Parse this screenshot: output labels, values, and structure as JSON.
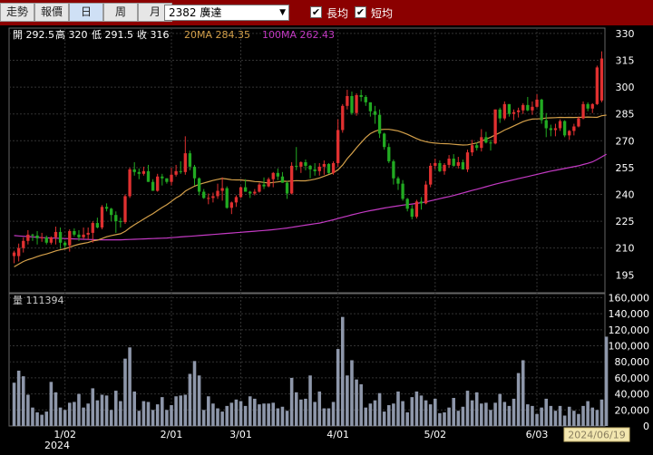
{
  "toolbar": {
    "tabs": [
      "走勢",
      "報價",
      "日",
      "周",
      "月"
    ],
    "active_tab": 2,
    "stock_select": "2382 廣達",
    "checkbox_long": {
      "label": "長均",
      "checked": true
    },
    "checkbox_short": {
      "label": "短均",
      "checked": true
    }
  },
  "info": {
    "open": "開 292.5",
    "high": "高 320",
    "low": "低 291.5",
    "close": "收 316",
    "ma20": "20MA 284.35",
    "ma100": "100MA 262.43",
    "volume": "量 111394"
  },
  "colors": {
    "up": "#e03030",
    "down": "#22aa22",
    "ma20": "#d4a04a",
    "ma100": "#c43ac4",
    "volume": "#8e97aa",
    "grid": "#333333",
    "titlebar": "#8b0000"
  },
  "hover_date": "2024/06/19",
  "chart_data": {
    "type": "candlestick",
    "price_axis_ticks": [
      330,
      315,
      300,
      285,
      270,
      255,
      240,
      225,
      210,
      195
    ],
    "price_range": [
      185,
      333
    ],
    "volume_axis_ticks": [
      "160,000",
      "140,000",
      "120,000",
      "100,000",
      "80,000",
      "60,000",
      "40,000",
      "20,000",
      "0"
    ],
    "volume_range": [
      0,
      165000
    ],
    "x_ticks": [
      {
        "label": "1/02",
        "index": 11
      },
      {
        "label": "2/01",
        "index": 34
      },
      {
        "label": "3/01",
        "index": 49
      },
      {
        "label": "4/01",
        "index": 70
      },
      {
        "label": "5/02",
        "index": 91
      },
      {
        "label": "6/03",
        "index": 113
      }
    ],
    "year_label": "2024",
    "ohlc": [
      [
        205.5,
        208.5,
        201.5,
        207.5
      ],
      [
        205.5,
        212.5,
        202.5,
        210.0
      ],
      [
        210.0,
        216.0,
        207.5,
        214.0
      ],
      [
        214.0,
        220.0,
        212.0,
        217.5
      ],
      [
        217.5,
        218.0,
        214.0,
        217.0
      ],
      [
        217.0,
        219.5,
        212.0,
        215.5
      ],
      [
        215.5,
        218.5,
        213.5,
        216.0
      ],
      [
        216.0,
        217.0,
        212.0,
        213.0
      ],
      [
        213.0,
        216.5,
        212.0,
        216.0
      ],
      [
        216.0,
        222.0,
        212.0,
        219.0
      ],
      [
        219.0,
        221.5,
        209.5,
        213.0
      ],
      [
        213.0,
        214.0,
        210.0,
        211.5
      ],
      [
        211.5,
        220.5,
        208.0,
        219.5
      ],
      [
        219.5,
        221.0,
        216.5,
        217.5
      ],
      [
        217.5,
        220.0,
        214.0,
        216.0
      ],
      [
        216.0,
        221.5,
        215.0,
        217.5
      ],
      [
        217.5,
        221.5,
        214.5,
        218.5
      ],
      [
        218.5,
        225.0,
        213.0,
        224.0
      ],
      [
        224.0,
        227.0,
        221.0,
        221.5
      ],
      [
        221.5,
        234.0,
        220.5,
        233.0
      ],
      [
        233.0,
        235.0,
        230.5,
        232.0
      ],
      [
        232.0,
        232.5,
        225.0,
        228.5
      ],
      [
        228.5,
        230.5,
        218.5,
        225.0
      ],
      [
        225.0,
        227.0,
        221.5,
        224.5
      ],
      [
        224.5,
        240.0,
        223.5,
        239.0
      ],
      [
        239.0,
        255.0,
        238.0,
        254.0
      ],
      [
        254.0,
        258.0,
        250.5,
        252.5
      ],
      [
        252.5,
        254.5,
        248.5,
        251.5
      ],
      [
        251.5,
        255.5,
        250.5,
        253.0
      ],
      [
        253.0,
        256.5,
        247.0,
        247.0
      ],
      [
        247.0,
        248.5,
        242.0,
        242.0
      ],
      [
        242.0,
        251.5,
        241.5,
        250.0
      ],
      [
        250.0,
        251.5,
        245.0,
        249.0
      ],
      [
        249.0,
        249.0,
        246.0,
        247.0
      ],
      [
        247.0,
        255.0,
        245.0,
        251.0
      ],
      [
        251.0,
        256.5,
        250.0,
        253.0
      ],
      [
        253.0,
        258.5,
        251.5,
        252.5
      ],
      [
        252.5,
        272.5,
        251.0,
        263.0
      ],
      [
        263.0,
        264.5,
        253.5,
        255.5
      ],
      [
        255.5,
        256.5,
        245.0,
        249.0
      ],
      [
        249.0,
        249.5,
        239.5,
        241.5
      ],
      [
        241.5,
        243.0,
        237.5,
        238.0
      ],
      [
        238.0,
        240.5,
        234.5,
        238.0
      ],
      [
        238.0,
        241.0,
        235.5,
        239.0
      ],
      [
        239.0,
        246.0,
        237.5,
        242.0
      ],
      [
        242.0,
        249.5,
        236.5,
        243.5
      ],
      [
        243.5,
        244.5,
        232.0,
        232.5
      ],
      [
        232.5,
        236.0,
        229.0,
        235.5
      ],
      [
        235.5,
        239.5,
        233.0,
        238.5
      ],
      [
        238.5,
        244.5,
        238.0,
        244.0
      ],
      [
        244.0,
        248.5,
        241.5,
        241.5
      ],
      [
        241.5,
        242.0,
        238.0,
        240.5
      ],
      [
        240.5,
        243.0,
        239.5,
        241.5
      ],
      [
        241.5,
        246.5,
        241.0,
        245.5
      ],
      [
        245.5,
        249.5,
        243.0,
        244.5
      ],
      [
        244.5,
        249.5,
        244.0,
        248.5
      ],
      [
        248.5,
        252.5,
        244.0,
        252.0
      ],
      [
        252.0,
        254.5,
        248.0,
        250.0
      ],
      [
        250.0,
        252.5,
        246.5,
        246.5
      ],
      [
        246.5,
        247.5,
        237.5,
        240.5
      ],
      [
        240.5,
        258.0,
        240.0,
        256.0
      ],
      [
        256.0,
        266.5,
        253.5,
        255.5
      ],
      [
        255.5,
        258.5,
        252.0,
        258.0
      ],
      [
        258.0,
        259.5,
        253.5,
        256.0
      ],
      [
        256.0,
        256.5,
        249.0,
        254.0
      ],
      [
        254.0,
        257.5,
        250.5,
        253.0
      ],
      [
        253.0,
        257.5,
        250.5,
        255.5
      ],
      [
        255.5,
        259.0,
        251.0,
        257.0
      ],
      [
        257.0,
        257.5,
        251.5,
        252.0
      ],
      [
        252.0,
        258.5,
        251.0,
        257.5
      ],
      [
        257.5,
        282.0,
        255.5,
        276.0
      ],
      [
        276.0,
        290.5,
        274.5,
        289.5
      ],
      [
        289.5,
        298.5,
        287.5,
        295.0
      ],
      [
        295.0,
        297.5,
        284.5,
        285.5
      ],
      [
        285.5,
        296.5,
        284.0,
        295.5
      ],
      [
        295.5,
        298.5,
        292.0,
        294.5
      ],
      [
        294.5,
        295.5,
        289.5,
        291.5
      ],
      [
        291.5,
        291.5,
        283.5,
        286.5
      ],
      [
        286.5,
        289.5,
        279.5,
        284.5
      ],
      [
        284.5,
        287.5,
        271.5,
        274.0
      ],
      [
        274.0,
        274.5,
        265.0,
        266.5
      ],
      [
        266.5,
        268.5,
        257.5,
        258.5
      ],
      [
        258.5,
        259.5,
        245.5,
        249.0
      ],
      [
        249.0,
        250.0,
        242.5,
        246.0
      ],
      [
        246.0,
        248.0,
        236.5,
        237.5
      ],
      [
        237.5,
        238.0,
        230.5,
        232.0
      ],
      [
        232.0,
        234.0,
        226.0,
        227.5
      ],
      [
        227.5,
        237.0,
        226.5,
        236.0
      ],
      [
        236.0,
        238.5,
        231.5,
        235.0
      ],
      [
        235.0,
        247.5,
        234.5,
        245.5
      ],
      [
        245.5,
        257.5,
        244.0,
        256.0
      ],
      [
        256.0,
        260.0,
        254.0,
        257.5
      ],
      [
        257.5,
        259.0,
        252.5,
        253.0
      ],
      [
        253.0,
        257.5,
        251.0,
        256.5
      ],
      [
        256.5,
        262.0,
        255.0,
        260.0
      ],
      [
        260.0,
        262.5,
        255.5,
        256.0
      ],
      [
        256.0,
        261.0,
        254.5,
        258.0
      ],
      [
        258.0,
        259.5,
        254.0,
        254.0
      ],
      [
        254.0,
        265.0,
        252.5,
        263.5
      ],
      [
        263.5,
        270.5,
        261.5,
        267.5
      ],
      [
        267.5,
        269.0,
        264.5,
        266.0
      ],
      [
        266.0,
        276.5,
        264.0,
        272.0
      ],
      [
        272.0,
        275.0,
        268.5,
        269.0
      ],
      [
        269.0,
        270.5,
        264.5,
        268.5
      ],
      [
        268.5,
        287.5,
        268.0,
        287.5
      ],
      [
        287.5,
        288.5,
        280.0,
        282.5
      ],
      [
        282.5,
        292.0,
        281.5,
        290.5
      ],
      [
        290.5,
        290.5,
        283.5,
        285.0
      ],
      [
        285.0,
        287.5,
        281.5,
        286.0
      ],
      [
        286.0,
        288.5,
        283.0,
        287.0
      ],
      [
        287.0,
        291.0,
        285.0,
        290.0
      ],
      [
        290.0,
        294.5,
        286.5,
        287.0
      ],
      [
        287.0,
        292.0,
        284.5,
        289.0
      ],
      [
        289.0,
        296.0,
        288.5,
        293.0
      ],
      [
        293.0,
        293.5,
        279.5,
        281.5
      ],
      [
        281.5,
        285.5,
        272.0,
        277.0
      ],
      [
        277.0,
        279.0,
        272.5,
        276.0
      ],
      [
        276.0,
        279.5,
        272.5,
        277.0
      ],
      [
        277.0,
        282.0,
        275.5,
        281.0
      ],
      [
        281.0,
        281.5,
        272.0,
        273.0
      ],
      [
        273.0,
        276.0,
        270.5,
        275.5
      ],
      [
        275.5,
        279.5,
        273.0,
        278.0
      ],
      [
        278.0,
        283.5,
        277.5,
        282.5
      ],
      [
        282.5,
        292.0,
        282.0,
        290.5
      ],
      [
        290.5,
        291.5,
        286.5,
        288.0
      ],
      [
        288.0,
        291.0,
        285.5,
        290.5
      ],
      [
        290.5,
        312.0,
        290.0,
        311.0
      ],
      [
        292.5,
        320.0,
        291.5,
        316.0
      ]
    ],
    "volume": [
      54000,
      69000,
      62000,
      39000,
      23000,
      17000,
      14000,
      18000,
      55000,
      42000,
      23000,
      20000,
      29000,
      30000,
      40000,
      23000,
      28000,
      47000,
      32000,
      39000,
      38000,
      20000,
      44000,
      31000,
      84000,
      98000,
      43000,
      19000,
      31000,
      30000,
      20000,
      27000,
      36000,
      20000,
      26000,
      37000,
      38000,
      39000,
      65000,
      81000,
      63000,
      20000,
      37000,
      28000,
      22000,
      18000,
      25000,
      29000,
      33000,
      31000,
      25000,
      37000,
      34000,
      27000,
      28000,
      28000,
      29000,
      22000,
      24000,
      19000,
      60000,
      42000,
      33000,
      34000,
      63000,
      30000,
      43000,
      22000,
      22000,
      30000,
      96000,
      136000,
      63000,
      82000,
      58000,
      52000,
      23000,
      28000,
      32000,
      41000,
      18000,
      26000,
      28000,
      43000,
      31000,
      17000,
      36000,
      43000,
      38000,
      32000,
      27000,
      34000,
      16000,
      17000,
      23000,
      35000,
      19000,
      24000,
      44000,
      32000,
      42000,
      28000,
      29000,
      20000,
      29000,
      40000,
      30000,
      25000,
      34000,
      66000,
      82000,
      27000,
      25000,
      15000,
      23000,
      34000,
      25000,
      19000,
      25000,
      13000,
      24000,
      19000,
      15000,
      25000,
      31000,
      23000,
      20000,
      33000,
      111394
    ],
    "ma20": [
      199.5,
      201.0,
      202.5,
      203.5,
      204.3,
      205.2,
      206.1,
      206.7,
      207.5,
      208.4,
      209.0,
      209.6,
      210.5,
      211.4,
      212.1,
      212.6,
      213.1,
      214.0,
      214.4,
      215.3,
      216.3,
      217.0,
      217.5,
      218.0,
      219.3,
      221.3,
      223.0,
      224.6,
      226.2,
      227.8,
      229.2,
      231.0,
      232.7,
      234.2,
      236.1,
      238.0,
      239.5,
      241.8,
      243.3,
      244.6,
      245.6,
      246.4,
      247.1,
      247.8,
      248.4,
      248.9,
      248.6,
      248.2,
      248.1,
      248.1,
      247.8,
      247.6,
      247.2,
      247.1,
      246.7,
      246.4,
      246.7,
      247.0,
      247.4,
      247.3,
      247.5,
      247.7,
      247.6,
      247.6,
      248.0,
      248.5,
      249.2,
      250.2,
      251.1,
      252.1,
      253.8,
      256.4,
      260.0,
      262.9,
      266.1,
      269.0,
      271.8,
      274.0,
      275.3,
      276.2,
      276.4,
      276.4,
      276.0,
      275.5,
      274.6,
      273.6,
      272.4,
      271.2,
      270.2,
      269.5,
      269.0,
      268.7,
      268.5,
      268.4,
      268.3,
      268.0,
      267.8,
      267.6,
      267.7,
      268.2,
      268.8,
      269.7,
      270.9,
      272.0,
      273.3,
      274.5,
      276.0,
      277.1,
      278.3,
      279.5,
      280.7,
      281.5,
      282.1,
      282.2,
      282.3,
      282.7,
      282.8,
      282.9,
      283.1,
      283.0,
      283.1,
      283.0,
      283.1,
      283.2,
      283.3,
      283.2,
      283.1,
      284.0,
      284.35
    ],
    "ma100": [
      217.0,
      216.8,
      216.6,
      216.4,
      216.2,
      216.0,
      215.8,
      215.7,
      215.6,
      215.5,
      215.4,
      215.3,
      215.2,
      215.1,
      215.0,
      214.9,
      214.8,
      214.7,
      214.6,
      214.6,
      214.6,
      214.6,
      214.6,
      214.6,
      214.7,
      214.8,
      214.9,
      215.0,
      215.1,
      215.2,
      215.3,
      215.4,
      215.5,
      215.6,
      215.8,
      216.0,
      216.2,
      216.4,
      216.6,
      216.8,
      217.0,
      217.2,
      217.4,
      217.6,
      217.8,
      218.0,
      218.2,
      218.4,
      218.6,
      218.8,
      219.0,
      219.2,
      219.4,
      219.6,
      219.8,
      220.0,
      220.3,
      220.6,
      220.9,
      221.2,
      221.6,
      222.0,
      222.4,
      222.8,
      223.2,
      223.6,
      224.0,
      224.6,
      225.2,
      225.8,
      226.5,
      227.2,
      227.9,
      228.6,
      229.2,
      229.8,
      230.4,
      230.9,
      231.4,
      231.9,
      232.4,
      232.8,
      233.2,
      233.6,
      234.0,
      234.3,
      234.6,
      235.0,
      235.4,
      235.8,
      236.4,
      237.0,
      237.6,
      238.2,
      238.8,
      239.4,
      240.1,
      240.8,
      241.5,
      242.2,
      242.9,
      243.6,
      244.3,
      245.0,
      245.7,
      246.4,
      247.0,
      247.6,
      248.2,
      248.8,
      249.4,
      250.0,
      250.6,
      251.2,
      251.8,
      252.4,
      253.0,
      253.5,
      254.0,
      254.5,
      255.0,
      255.5,
      256.0,
      256.7,
      257.4,
      258.2,
      259.5,
      261.0,
      262.43
    ]
  }
}
